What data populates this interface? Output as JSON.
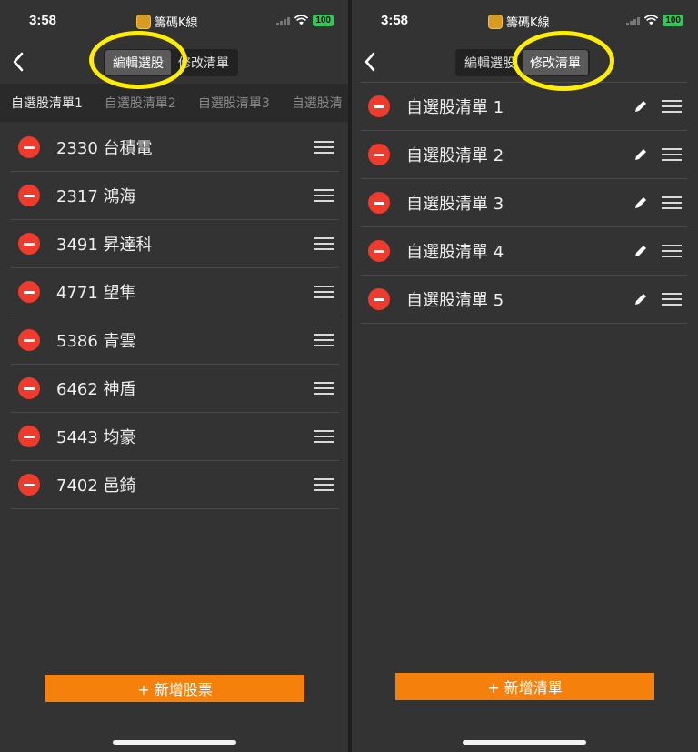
{
  "left": {
    "status": {
      "time": "3:58",
      "app_name": "籌碼K線",
      "battery": "100"
    },
    "segments": [
      "編輯選股",
      "修改清單"
    ],
    "tabs": [
      "自選股清單1",
      "自選股清單2",
      "自選股清單3",
      "自選股清"
    ],
    "stocks": [
      "2330 台積電",
      "2317 鴻海",
      "3491 昇達科",
      "4771 望隼",
      "5386 青雲",
      "6462 神盾",
      "5443 均豪",
      "7402 邑錡"
    ],
    "add_button": "+ 新增股票"
  },
  "right": {
    "status": {
      "time": "3:58",
      "app_name": "籌碼K線",
      "battery": "100"
    },
    "segments": [
      "編輯選股",
      "修改清單"
    ],
    "lists": [
      "自選股清單 1",
      "自選股清單 2",
      "自選股清單 3",
      "自選股清單 4",
      "自選股清單 5"
    ],
    "add_button": "+ 新增清單"
  },
  "colors": {
    "background": "#333333",
    "accent": "#f5800b",
    "delete": "#ef3b2d",
    "annotation": "#ffee00",
    "battery": "#34c759"
  },
  "icons": [
    "back-chevron-icon",
    "minus-circle-icon",
    "drag-handle-icon",
    "pencil-icon",
    "wifi-icon",
    "signal-icon"
  ]
}
